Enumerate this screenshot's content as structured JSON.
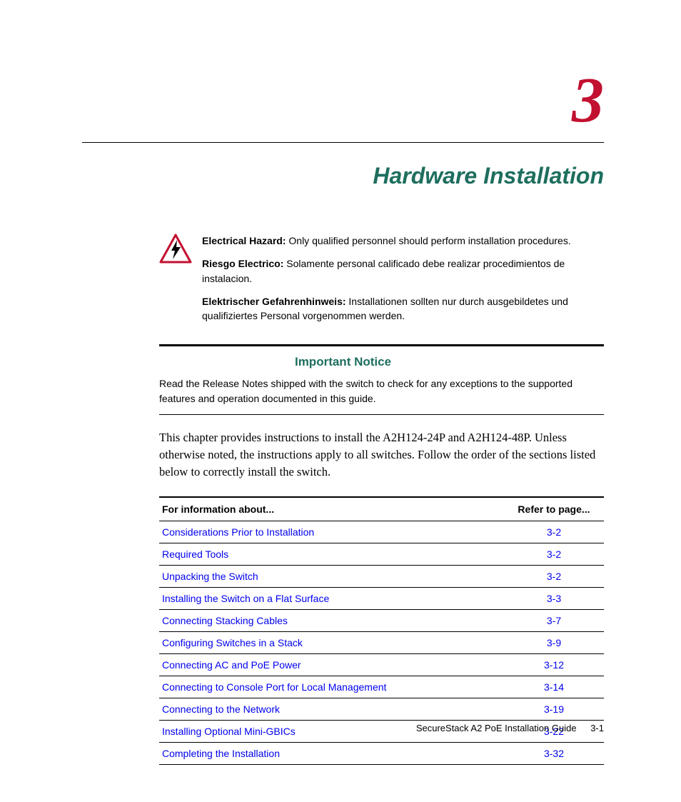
{
  "chapter": {
    "number": "3",
    "title": "Hardware Installation"
  },
  "hazard": {
    "en_label": "Electrical Hazard:",
    "en_text": " Only qualified personnel should perform installation procedures.",
    "es_label": "Riesgo Electrico:",
    "es_text": " Solamente personal calificado debe realizar procedimientos de instalacion.",
    "de_label": "Elektrischer Gefahrenhinweis:",
    "de_text": " Installationen sollten nur durch ausgebildetes und qualifiziertes Personal vorgenommen werden."
  },
  "notice": {
    "heading": "Important Notice",
    "body": "Read the Release Notes shipped with the switch to check for any exceptions to the supported features and operation documented in this guide."
  },
  "intro": "This chapter provides instructions to install the A2H124-24P and A2H124-48P. Unless otherwise noted, the instructions apply to all switches. Follow the order of the sections listed below to correctly install the switch.",
  "toc": {
    "col1": "For information about...",
    "col2": "Refer to page...",
    "rows": [
      {
        "topic": "Considerations Prior to Installation",
        "page": "3-2"
      },
      {
        "topic": "Required Tools",
        "page": "3-2"
      },
      {
        "topic": "Unpacking the Switch",
        "page": "3-2"
      },
      {
        "topic": "Installing the Switch on a Flat Surface",
        "page": "3-3"
      },
      {
        "topic": "Connecting Stacking Cables",
        "page": "3-7"
      },
      {
        "topic": "Configuring Switches in a Stack",
        "page": "3-9"
      },
      {
        "topic": "Connecting AC and PoE Power",
        "page": "3-12"
      },
      {
        "topic": "Connecting to Console Port for Local Management",
        "page": "3-14"
      },
      {
        "topic": "Connecting to the Network",
        "page": "3-19"
      },
      {
        "topic": "Installing Optional Mini-GBICs",
        "page": "3-22"
      },
      {
        "topic": "Completing the Installation",
        "page": "3-32"
      }
    ]
  },
  "footer": {
    "guide": "SecureStack A2 PoE Installation Guide",
    "page": "3-1"
  }
}
